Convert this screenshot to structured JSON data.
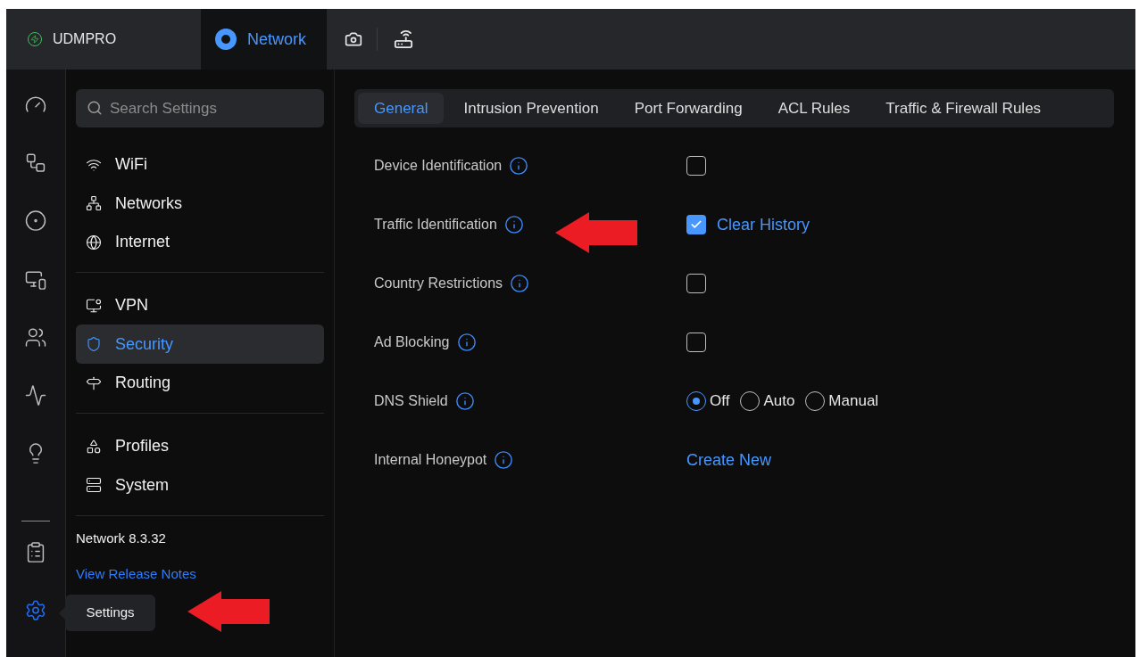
{
  "topbar": {
    "console": "UDMPRO",
    "apps": [
      {
        "label": "Network",
        "selected": true
      }
    ]
  },
  "rail": [
    {
      "selected": false
    },
    {
      "selected": false
    },
    {
      "selected": false
    },
    {
      "selected": false
    },
    {
      "selected": false
    },
    {
      "selected": false
    },
    {
      "selected": false
    },
    {
      "selected": false
    },
    {
      "selected": true
    }
  ],
  "tooltip": "Settings",
  "sidebar": {
    "search": {
      "placeholder": "Search Settings"
    },
    "groups": [
      [
        {
          "label": "WiFi",
          "selected": false
        },
        {
          "label": "Networks",
          "selected": false
        },
        {
          "label": "Internet",
          "selected": false
        }
      ],
      [
        {
          "label": "VPN",
          "selected": false
        },
        {
          "label": "Security",
          "selected": true
        },
        {
          "label": "Routing",
          "selected": false
        }
      ],
      [
        {
          "label": "Profiles",
          "selected": false
        },
        {
          "label": "System",
          "selected": false
        }
      ]
    ],
    "version": "Network 8.3.32",
    "release_notes": "View Release Notes"
  },
  "tabs": [
    {
      "label": "General",
      "selected": true
    },
    {
      "label": "Intrusion Prevention",
      "selected": false
    },
    {
      "label": "Port Forwarding",
      "selected": false
    },
    {
      "label": "ACL Rules",
      "selected": false
    },
    {
      "label": "Traffic & Firewall Rules",
      "selected": false
    }
  ],
  "settings": [
    {
      "label": "Device Identification",
      "kind": "checkbox",
      "checked": false
    },
    {
      "label": "Traffic Identification",
      "kind": "checkbox",
      "checked": true,
      "action": "Clear History"
    },
    {
      "label": "Country Restrictions",
      "kind": "checkbox",
      "checked": false
    },
    {
      "label": "Ad Blocking",
      "kind": "checkbox",
      "checked": false
    },
    {
      "label": "DNS Shield",
      "kind": "radio",
      "options": [
        {
          "label": "Off",
          "selected": true
        },
        {
          "label": "Auto",
          "selected": false
        },
        {
          "label": "Manual",
          "selected": false
        }
      ]
    },
    {
      "label": "Internal Honeypot",
      "kind": "link",
      "link": "Create New"
    }
  ]
}
